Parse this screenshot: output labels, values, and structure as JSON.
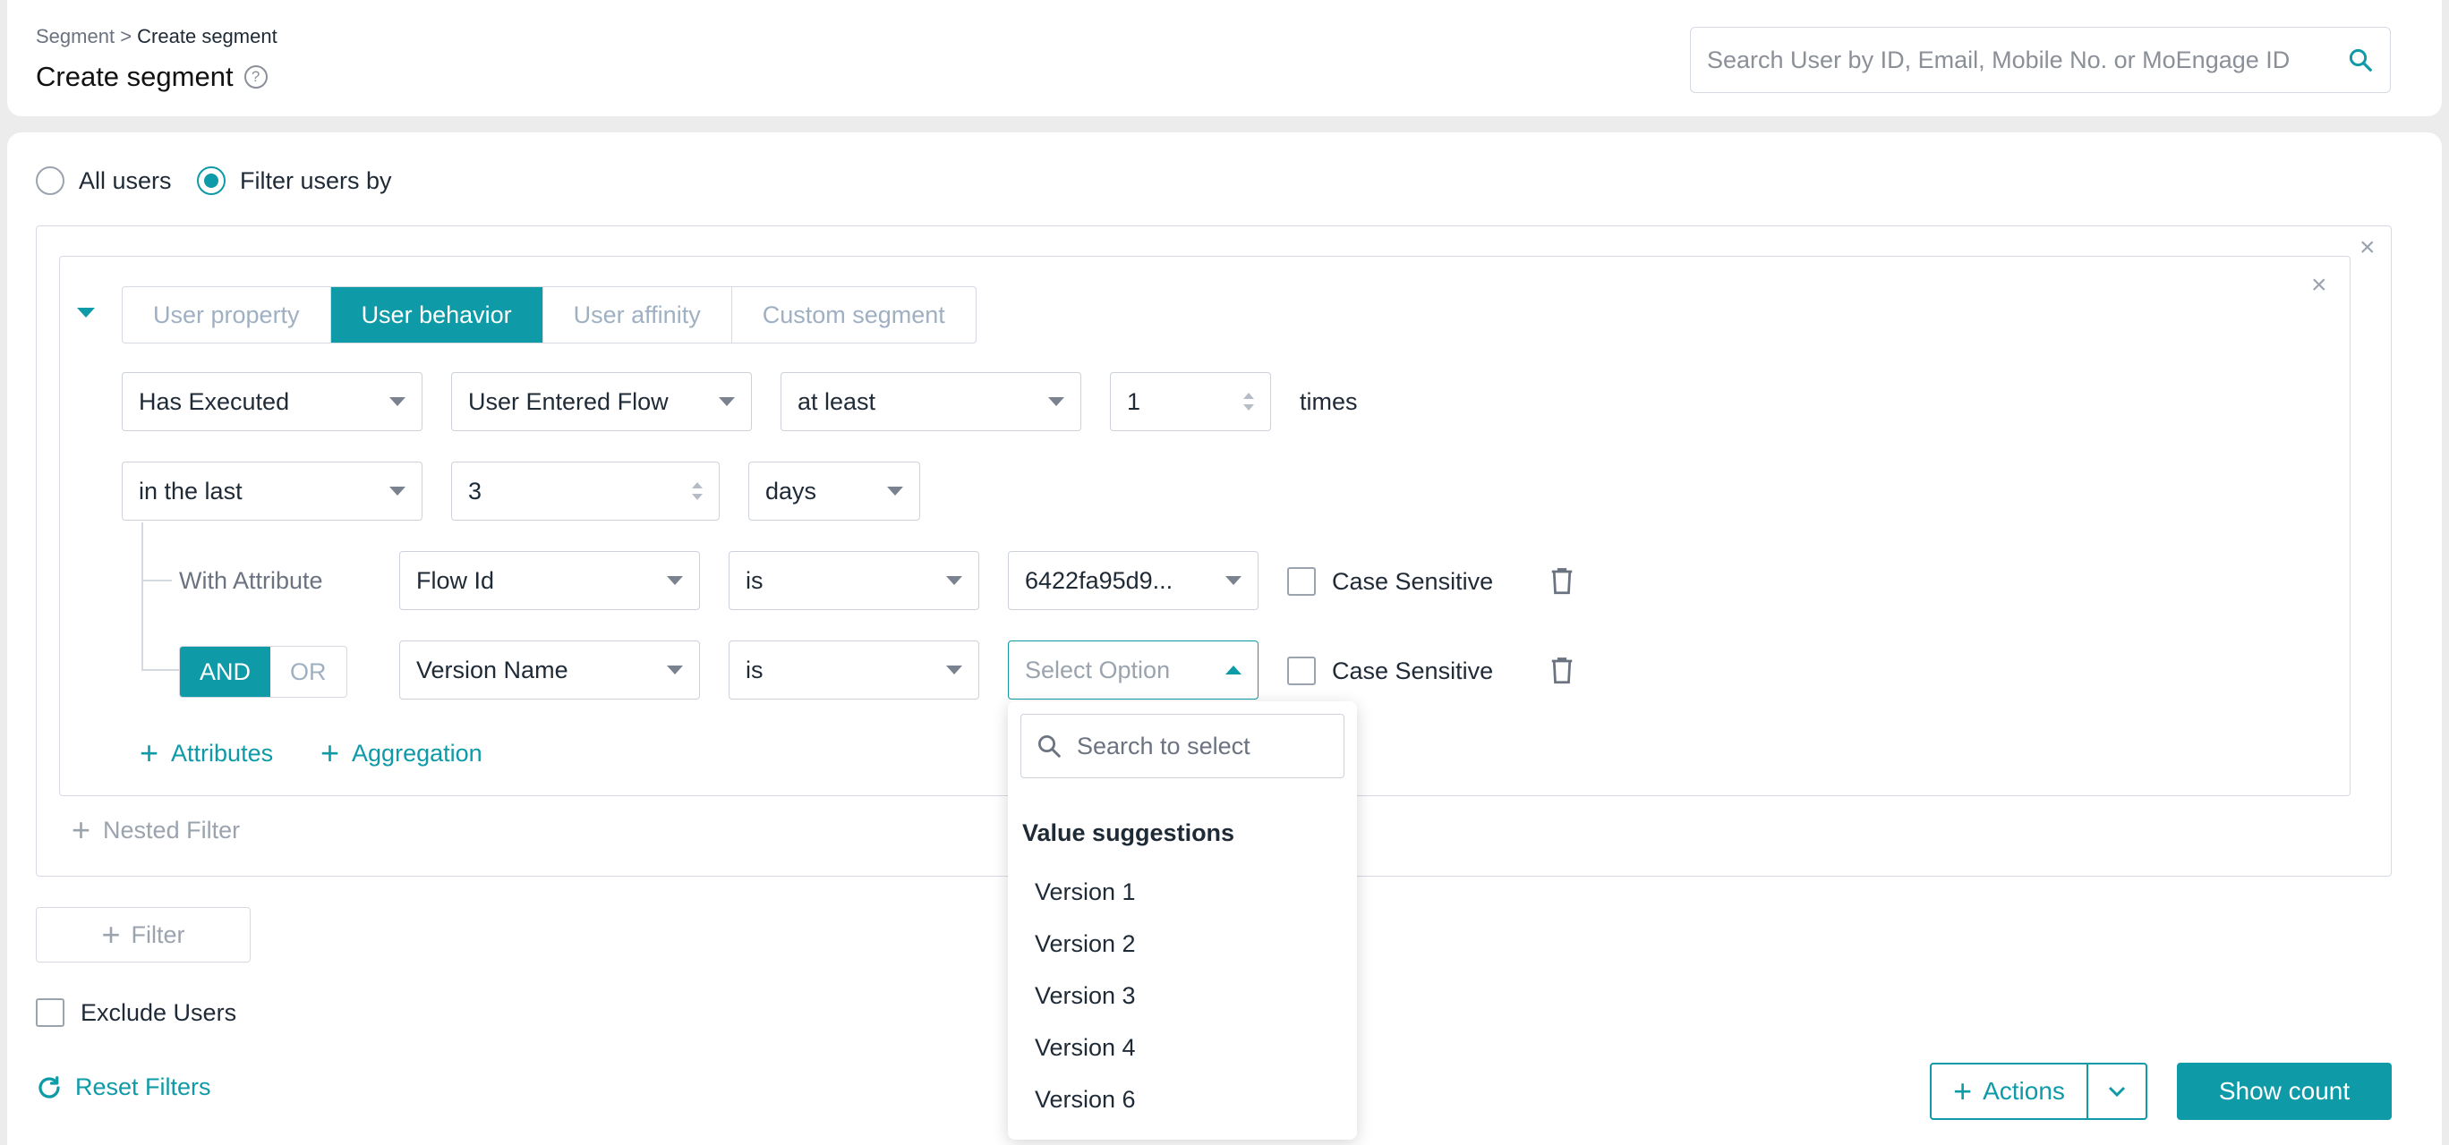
{
  "header": {
    "breadcrumb_parent": "Segment",
    "breadcrumb_sep": ">",
    "breadcrumb_current": "Create segment",
    "title": "Create segment",
    "help_icon": "question-circle-icon",
    "search_placeholder": "Search User by ID, Email, Mobile No. or MoEngage ID"
  },
  "audience": {
    "all_users_label": "All users",
    "filter_users_label": "Filter users by",
    "selected": "Filter users by"
  },
  "filter": {
    "tabs": [
      "User property",
      "User behavior",
      "User affinity",
      "Custom segment"
    ],
    "active_tab": "User behavior",
    "row1": {
      "condition": "Has Executed",
      "event": "User Entered Flow",
      "operator": "at least",
      "count": "1",
      "suffix": "times"
    },
    "row2": {
      "period": "in the last",
      "value": "3",
      "unit": "days"
    },
    "attributes": [
      {
        "prefix": "With Attribute",
        "name": "Flow Id",
        "operator": "is",
        "value": "6422fa95d9...",
        "case_label": "Case Sensitive"
      },
      {
        "name": "Version Name",
        "operator": "is",
        "value_placeholder": "Select Option",
        "case_label": "Case Sensitive"
      }
    ],
    "logic": {
      "and": "AND",
      "or": "OR",
      "active": "AND"
    },
    "add_attributes": "Attributes",
    "add_aggregation": "Aggregation",
    "nested_filter": "Nested Filter"
  },
  "dropdown": {
    "search_placeholder": "Search to select",
    "heading": "Value suggestions",
    "options": [
      "Version 1",
      "Version 2",
      "Version 3",
      "Version 4",
      "Version 6"
    ]
  },
  "footer": {
    "add_filter": "Filter",
    "exclude_users": "Exclude Users",
    "reset_filters": "Reset Filters",
    "actions": "Actions",
    "show_count": "Show count"
  },
  "colors": {
    "accent": "#0e9aa7",
    "background": "#ececec"
  }
}
